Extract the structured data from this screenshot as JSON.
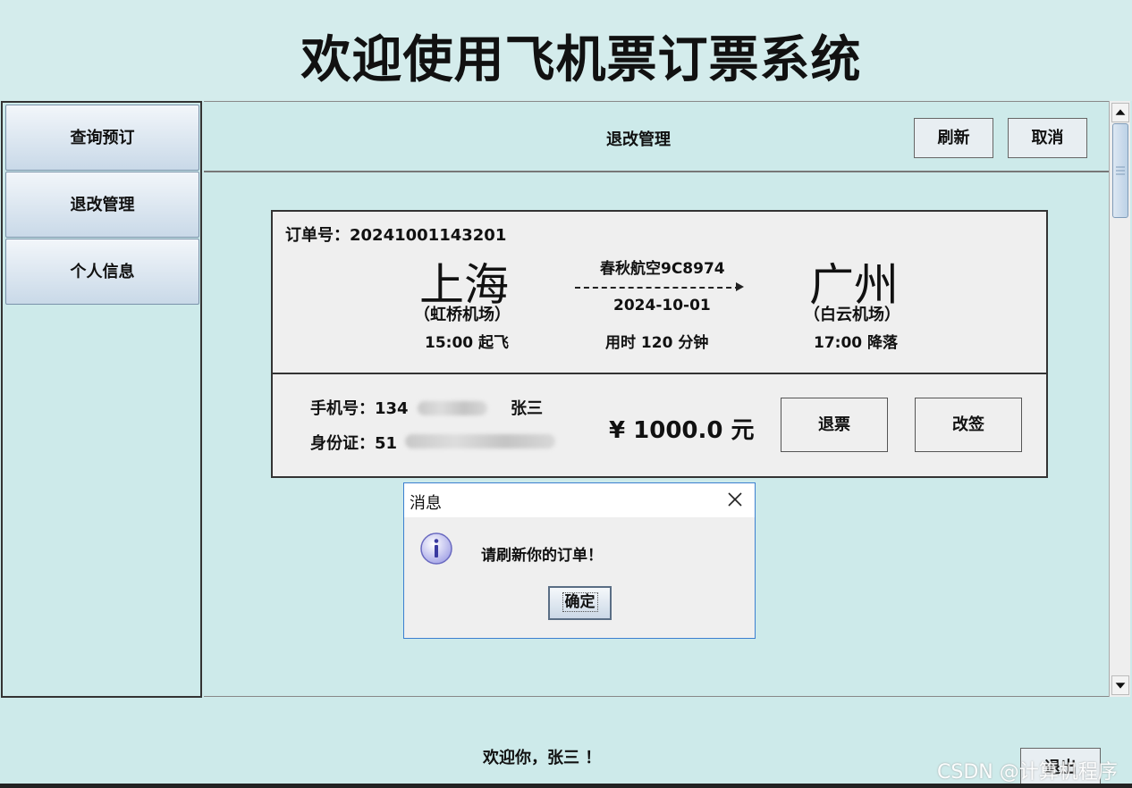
{
  "app": {
    "title": "欢迎使用飞机票订票系统"
  },
  "sidebar": {
    "items": [
      {
        "label": "查询预订"
      },
      {
        "label": "退改管理"
      },
      {
        "label": "个人信息"
      }
    ]
  },
  "header": {
    "section_title": "退改管理",
    "refresh_label": "刷新",
    "cancel_label": "取消"
  },
  "order": {
    "order_label": "订单号：",
    "order_no": "20241001143201",
    "from_city": "上海",
    "from_airport": "（虹桥机场）",
    "depart_time": "15:00 起飞",
    "airline_flight": "春秋航空9C8974",
    "date": "2024-10-01",
    "duration": "用时 120 分钟",
    "to_city": "广州",
    "to_airport": "（白云机场）",
    "arrive_time": "17:00 降落",
    "phone_label": "手机号：",
    "phone_visible": "134",
    "passenger_name": "张三",
    "id_label": "身份证：",
    "id_visible": "51",
    "price": "¥ 1000.0 元",
    "refund_label": "退票",
    "change_label": "改签"
  },
  "dialog": {
    "title": "消息",
    "message": "请刷新你的订单！",
    "ok_label": "确定",
    "icon": "info-icon"
  },
  "footer": {
    "greeting": "欢迎你，张三 ！",
    "button_label": "退出",
    "watermark": "CSDN @计算机程序"
  },
  "colors": {
    "background": "#cdeaea",
    "card": "#efefef",
    "dialog_border": "#3b7fd0"
  }
}
